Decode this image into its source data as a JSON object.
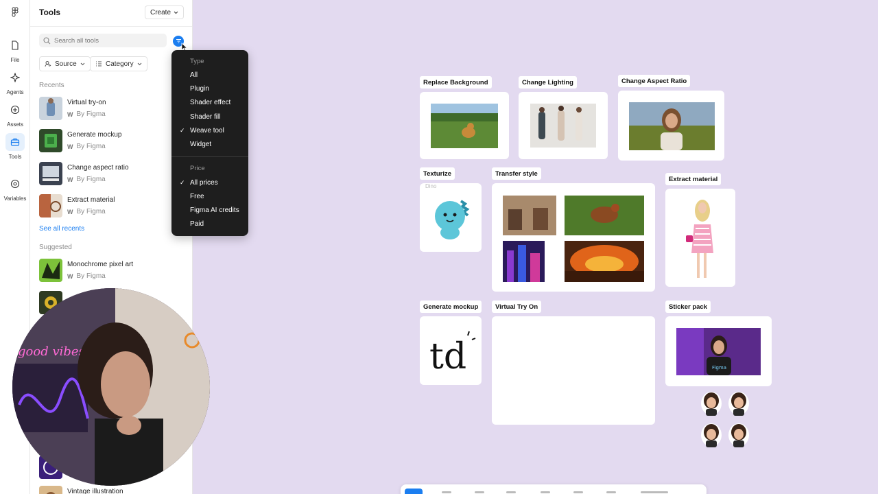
{
  "rail": {
    "items": [
      {
        "label": "File",
        "icon": "file-icon"
      },
      {
        "label": "Agents",
        "icon": "sparkle-icon"
      },
      {
        "label": "Assets",
        "icon": "plus-circle-icon"
      },
      {
        "label": "Tools",
        "icon": "toolbox-icon"
      },
      {
        "label": "Variables",
        "icon": "variables-icon"
      }
    ]
  },
  "panel": {
    "title": "Tools",
    "create_label": "Create",
    "search_placeholder": "Search all tools",
    "chips": {
      "source": "Source",
      "category": "Category"
    },
    "recents_label": "Recents",
    "recents": [
      {
        "name": "Virtual try-on",
        "by": "By Figma"
      },
      {
        "name": "Generate mockup",
        "by": "By Figma"
      },
      {
        "name": "Change aspect ratio",
        "by": "By Figma"
      },
      {
        "name": "Extract material",
        "by": "By Figma"
      }
    ],
    "see_all": "See all recents",
    "suggested_label": "Suggested",
    "suggested": [
      {
        "name": "Monochrome pixel art",
        "by": "By Figma"
      },
      {
        "name": "Vintage illustration",
        "by": ""
      }
    ]
  },
  "dropdown": {
    "type_header": "Type",
    "type_options": [
      "All",
      "Plugin",
      "Shader effect",
      "Shader fill",
      "Weave tool",
      "Widget"
    ],
    "type_selected": "Weave tool",
    "price_header": "Price",
    "price_options": [
      "All prices",
      "Free",
      "Figma AI credits",
      "Paid"
    ],
    "price_selected": "All prices",
    "check": "✓"
  },
  "canvas": {
    "cards": {
      "replace_background": "Replace Background",
      "change_lighting": "Change Lighting",
      "change_aspect_ratio": "Change Aspect Ratio",
      "texturize": "Texturize",
      "transfer_style": "Transfer style",
      "extract_material": "Extract material",
      "generate_mockup": "Generate mockup",
      "virtual_try_on": "Virtual Try On",
      "sticker_pack": "Sticker pack"
    },
    "ghost_text": "Dino",
    "mockup_text": "td",
    "shirt_text": "Figma",
    "neon_text": "good vibes"
  },
  "colors": {
    "canvas": "#e3daf0",
    "accent": "#1b7ef0",
    "menu": "#1e1e1e"
  }
}
